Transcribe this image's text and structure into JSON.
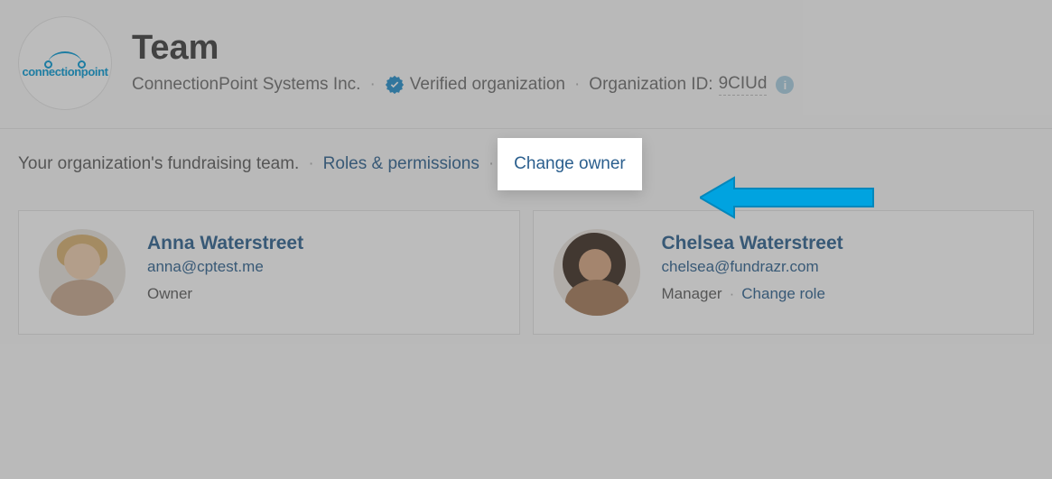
{
  "header": {
    "title": "Team",
    "org_name": "ConnectionPoint Systems Inc.",
    "verified_label": "Verified organization",
    "org_id_label": "Organization ID:",
    "org_id_value": "9CIUd",
    "logo_text": "connectionpoint"
  },
  "intro": {
    "text": "Your organization's fundraising team.",
    "roles_link": "Roles & permissions",
    "change_owner_link": "Change owner"
  },
  "members": [
    {
      "name": "Anna Waterstreet",
      "email": "anna@cptest.me",
      "role": "Owner",
      "change_role": null
    },
    {
      "name": "Chelsea Waterstreet",
      "email": "chelsea@fundrazr.com",
      "role": "Manager",
      "change_role": "Change role"
    }
  ],
  "colors": {
    "link": "#2b5f8e",
    "accent": "#00a3e0"
  }
}
